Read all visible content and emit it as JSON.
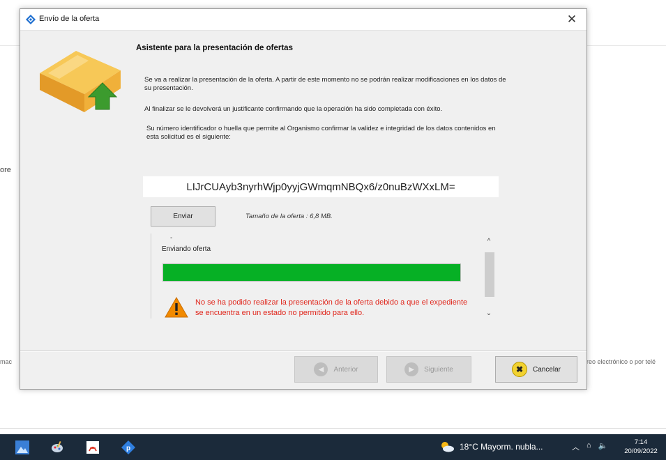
{
  "dialog": {
    "title": "Envío de la oferta",
    "close_glyph": "✕",
    "heading": "Asistente para la presentación de ofertas",
    "paragraph_1": "Se va a realizar la presentación de la oferta. A partir de este momento no se podrán realizar modificaciones en los datos de su presentación.",
    "paragraph_2": "Al finalizar se le devolverá un justificante confirmando que la operación ha sido completada con éxito.",
    "paragraph_3": "Su número identificador o huella que permite al Organismo confirmar la validez e integridad de los datos contenidos en esta solicitud es el siguiente:",
    "hash": "LIJrCUAyb3nyrhWjp0yyjGWmqmNBQx6/z0nuBzWXxLM=",
    "send_button": "Enviar",
    "offer_size": "Tamaño de la oferta : 6,8 MB.",
    "log": {
      "dash": "-",
      "status": "Enviando oferta",
      "progress_percent": 100,
      "error": "No se ha podido realizar la presentación de la oferta debido a que el expediente se encuentra en un estado no permitido para ello."
    },
    "footer": {
      "previous": "Anterior",
      "next": "Siguiente",
      "cancel": "Cancelar"
    }
  },
  "background": {
    "left_fragment": "ore",
    "left_fragment_2": "mac",
    "right_fragment": "reo electrónico o por telé"
  },
  "taskbar": {
    "weather": "18°C  Mayorm. nubla...",
    "time": "7:14",
    "date": "20/09/2022",
    "colors": {
      "bar": "#1b2a3a",
      "progress": "#06b025",
      "error": "#e0281e"
    },
    "icons": [
      "photos-icon",
      "paint-icon",
      "pdf-icon",
      "tool-icon"
    ]
  }
}
